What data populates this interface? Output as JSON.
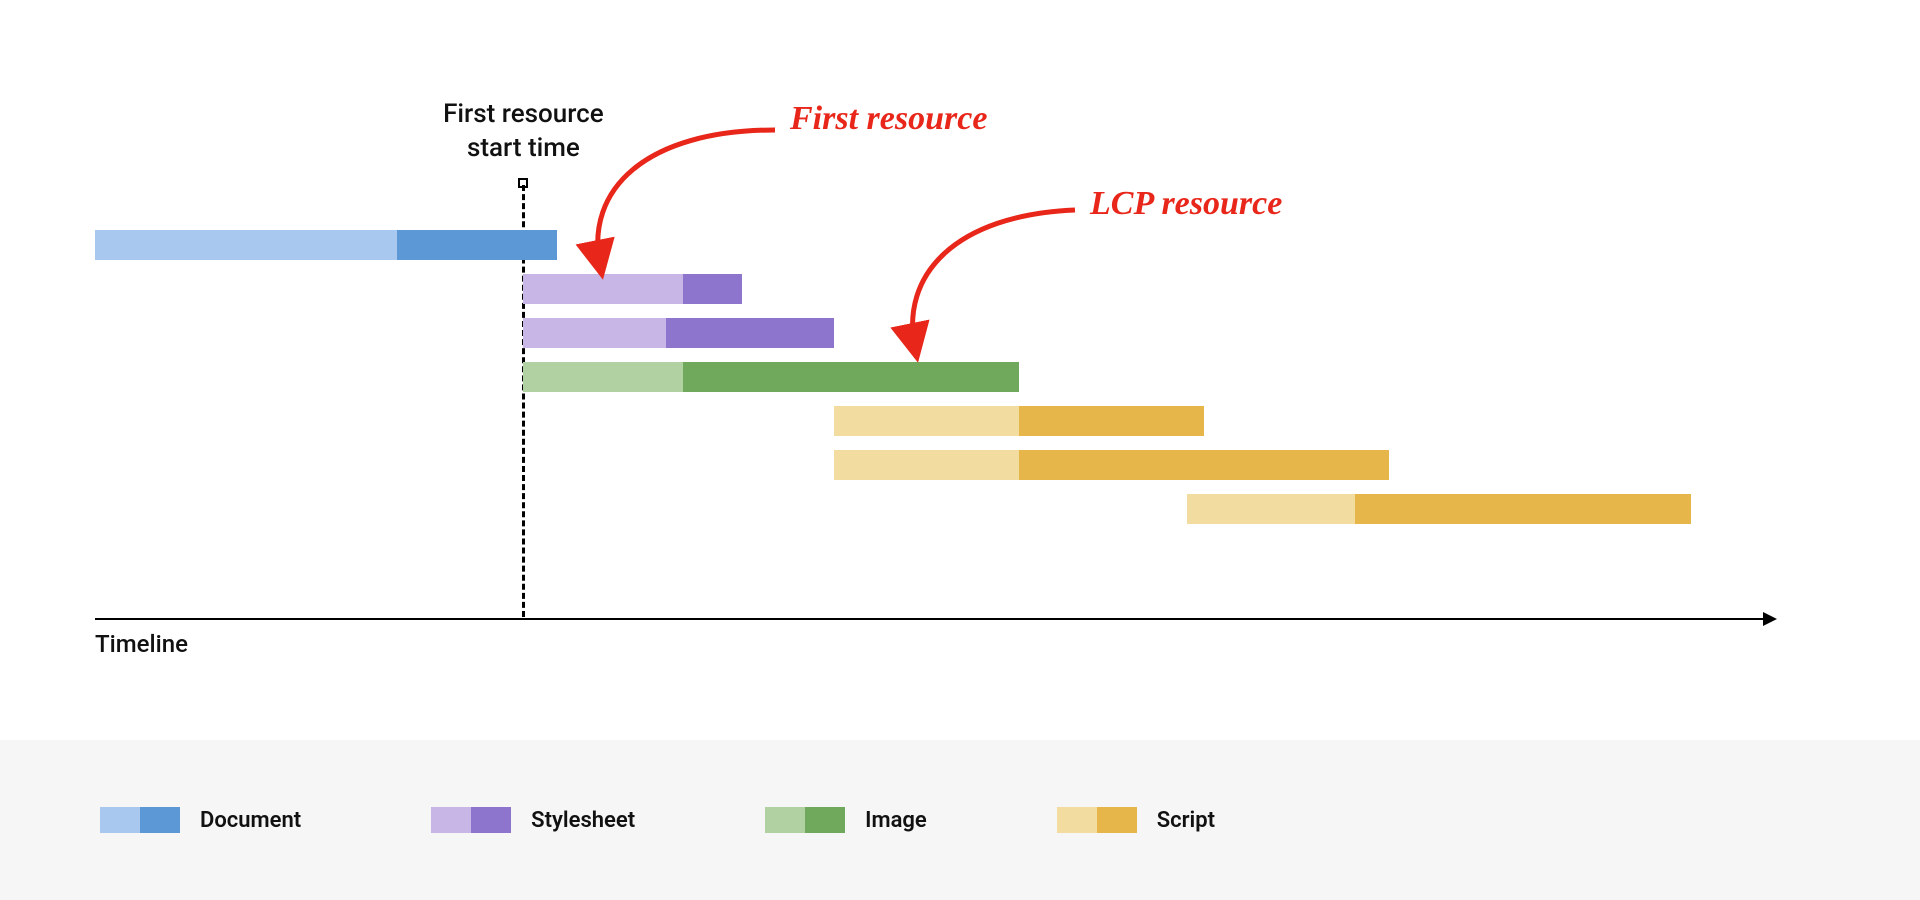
{
  "chart_data": {
    "type": "bar",
    "title": "",
    "xlabel": "Timeline",
    "ylabel": "",
    "xlim": [
      0,
      100
    ],
    "marker": {
      "label": "First resource\nstart time",
      "x": 25.5
    },
    "annotations": [
      {
        "id": "first-resource",
        "text": "First resource",
        "color": "#e8261a"
      },
      {
        "id": "lcp-resource",
        "text": "LCP resource",
        "color": "#e8261a"
      }
    ],
    "series": [
      {
        "name": "Document",
        "light": "#a9c8ef",
        "dark": "#5c97d6",
        "start": 0,
        "split": 18,
        "end": 27.5
      },
      {
        "name": "Stylesheet",
        "light": "#c7b6e6",
        "dark": "#8d74cc",
        "start": 25.5,
        "split": 35,
        "end": 38.5
      },
      {
        "name": "Stylesheet",
        "light": "#c7b6e6",
        "dark": "#8d74cc",
        "start": 25.5,
        "split": 34,
        "end": 44
      },
      {
        "name": "Image",
        "light": "#b2d1a3",
        "dark": "#70a85c",
        "start": 25.5,
        "split": 35,
        "end": 55
      },
      {
        "name": "Script",
        "light": "#f2dca0",
        "dark": "#e6b64b",
        "start": 44,
        "split": 55,
        "end": 66
      },
      {
        "name": "Script",
        "light": "#f2dca0",
        "dark": "#e6b64b",
        "start": 44,
        "split": 55,
        "end": 77
      },
      {
        "name": "Script",
        "light": "#f2dca0",
        "dark": "#e6b64b",
        "start": 65,
        "split": 75,
        "end": 95
      }
    ],
    "legend": [
      {
        "label": "Document",
        "light": "#a9c8ef",
        "dark": "#5c97d6"
      },
      {
        "label": "Stylesheet",
        "light": "#c7b6e6",
        "dark": "#8d74cc"
      },
      {
        "label": "Image",
        "light": "#b2d1a3",
        "dark": "#70a85c"
      },
      {
        "label": "Script",
        "light": "#f2dca0",
        "dark": "#e6b64b"
      }
    ]
  }
}
